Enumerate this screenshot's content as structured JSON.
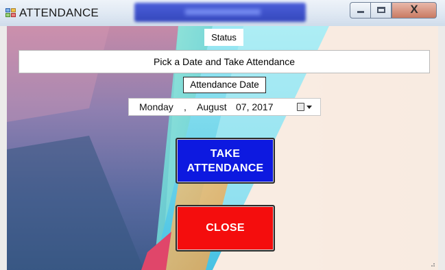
{
  "window": {
    "title": "ATTENDANCE",
    "icon": "app-window-icon",
    "controls": [
      "minimize-icon",
      "maximize-icon",
      "close-icon"
    ],
    "close_glyph": "X"
  },
  "status": {
    "label": "Status",
    "message": "Pick a Date and Take Attendance"
  },
  "date": {
    "label": "Attendance Date",
    "day": "Monday",
    "separator": ",",
    "month": "August",
    "date": "07, 2017",
    "dropdown_icon": "calendar-dropdown-icon"
  },
  "buttons": {
    "take_attendance_line1": "TAKE",
    "take_attendance_line2": "ATTENDANCE",
    "close": "CLOSE"
  },
  "colors": {
    "take_button": "#0d19e0",
    "close_button": "#f40d0d"
  }
}
